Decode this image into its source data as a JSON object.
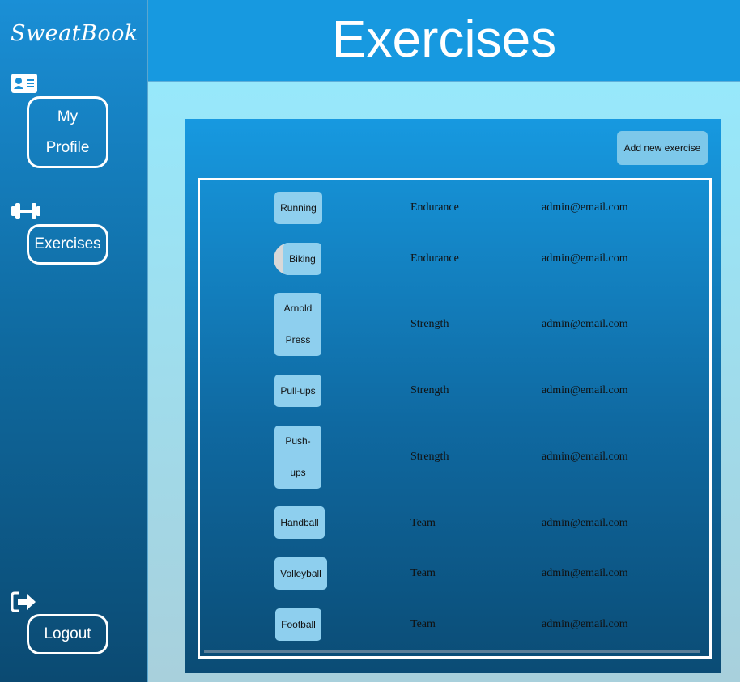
{
  "app": {
    "brand": "SweatBook"
  },
  "sidebar": {
    "profile_label_line1": "My",
    "profile_label_line2": "Profile",
    "exercises_label": "Exercises",
    "logout_label": "Logout",
    "icons": [
      "contact-card-icon",
      "dumbbell-icon",
      "logout-icon"
    ]
  },
  "header": {
    "title": "Exercises"
  },
  "toolbar": {
    "add_label": "Add new exercise"
  },
  "exercises": [
    {
      "name": "Running",
      "category": "Endurance",
      "owner": "admin@email.com"
    },
    {
      "name": "Biking",
      "category": "Endurance",
      "owner": "admin@email.com"
    },
    {
      "name": "Arnold Press",
      "category": "Strength",
      "owner": "admin@email.com"
    },
    {
      "name": "Pull-ups",
      "category": "Strength",
      "owner": "admin@email.com"
    },
    {
      "name": "Push-ups",
      "category": "Strength",
      "owner": "admin@email.com"
    },
    {
      "name": "Handball",
      "category": "Team",
      "owner": "admin@email.com"
    },
    {
      "name": "Volleyball",
      "category": "Team",
      "owner": "admin@email.com"
    },
    {
      "name": "Football",
      "category": "Team",
      "owner": "admin@email.com"
    }
  ],
  "colors": {
    "header": "#1799e0",
    "panel_top": "#1799e0",
    "panel_bottom": "#0b4c75",
    "button": "#8ecfee",
    "page_bg": "#97e8fb"
  }
}
